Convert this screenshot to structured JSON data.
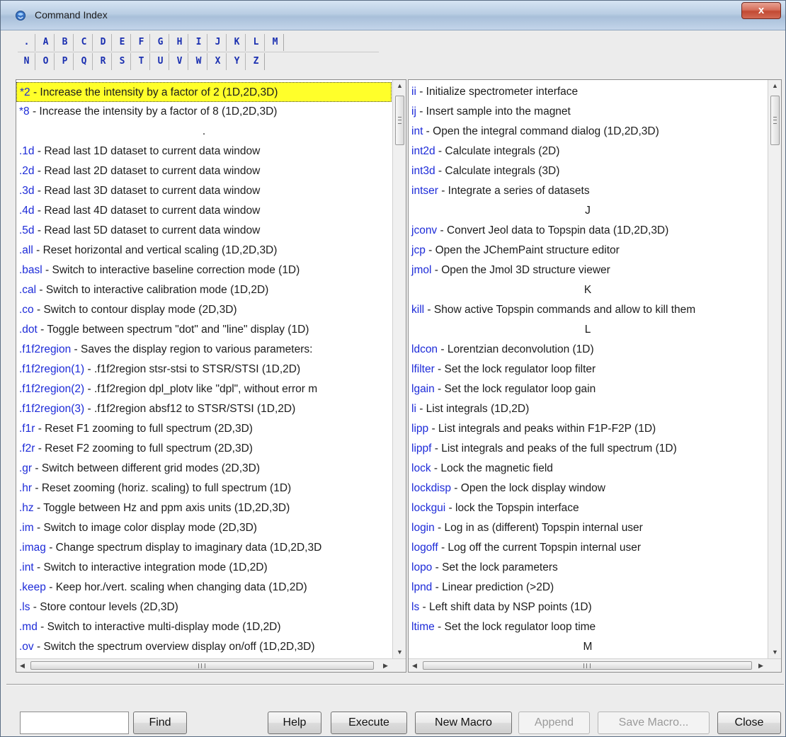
{
  "window": {
    "title": "Command Index",
    "close_label": "x"
  },
  "letters_row1": [
    ".",
    "A",
    "B",
    "C",
    "D",
    "E",
    "F",
    "G",
    "H",
    "I",
    "J",
    "K",
    "L",
    "M"
  ],
  "letters_row2": [
    "N",
    "O",
    "P",
    "Q",
    "R",
    "S",
    "T",
    "U",
    "V",
    "W",
    "X",
    "Y",
    "Z"
  ],
  "left_list": [
    {
      "cmd": "*2",
      "desc": " - Increase the intensity by a factor of 2 (1D,2D,3D)",
      "selected": true
    },
    {
      "cmd": "*8",
      "desc": " - Increase the intensity by a factor of 8 (1D,2D,3D)"
    },
    {
      "header": "."
    },
    {
      "cmd": ".1d",
      "desc": " - Read last 1D dataset to current data window"
    },
    {
      "cmd": ".2d",
      "desc": " - Read last 2D dataset to current data window"
    },
    {
      "cmd": ".3d",
      "desc": " - Read last 3D dataset to current data window"
    },
    {
      "cmd": ".4d",
      "desc": " - Read last 4D dataset to current data window"
    },
    {
      "cmd": ".5d",
      "desc": " - Read last 5D dataset to current data window"
    },
    {
      "cmd": ".all",
      "desc": " - Reset horizontal and vertical scaling (1D,2D,3D)"
    },
    {
      "cmd": ".basl",
      "desc": " - Switch to interactive baseline correction mode (1D)"
    },
    {
      "cmd": ".cal",
      "desc": " - Switch to interactive calibration mode (1D,2D)"
    },
    {
      "cmd": ".co",
      "desc": " - Switch to contour display mode (2D,3D)"
    },
    {
      "cmd": ".dot",
      "desc": " - Toggle between spectrum \"dot\" and \"line\" display (1D)"
    },
    {
      "cmd": ".f1f2region",
      "desc": " - Saves the display region to various parameters:"
    },
    {
      "cmd": ".f1f2region(1)",
      "desc": " - .f1f2region stsr-stsi to STSR/STSI (1D,2D)"
    },
    {
      "cmd": ".f1f2region(2)",
      "desc": " - .f1f2region dpl_plotv like \"dpl\", without error m"
    },
    {
      "cmd": ".f1f2region(3)",
      "desc": " - .f1f2region absf12 to STSR/STSI (1D,2D)"
    },
    {
      "cmd": ".f1r",
      "desc": " - Reset F1 zooming to full spectrum (2D,3D)"
    },
    {
      "cmd": ".f2r",
      "desc": " - Reset F2 zooming to full spectrum (2D,3D)"
    },
    {
      "cmd": ".gr",
      "desc": " - Switch between different grid modes (2D,3D)"
    },
    {
      "cmd": ".hr",
      "desc": " - Reset zooming (horiz. scaling) to full spectrum (1D)"
    },
    {
      "cmd": ".hz",
      "desc": " - Toggle between Hz and ppm axis units (1D,2D,3D)"
    },
    {
      "cmd": ".im",
      "desc": " - Switch to image color display mode (2D,3D)"
    },
    {
      "cmd": ".imag",
      "desc": " - Change spectrum display to imaginary data (1D,2D,3D"
    },
    {
      "cmd": ".int",
      "desc": " - Switch to interactive integration mode (1D,2D)"
    },
    {
      "cmd": ".keep",
      "desc": " - Keep hor./vert. scaling when changing data (1D,2D)"
    },
    {
      "cmd": ".ls",
      "desc": " - Store contour levels (2D,3D)"
    },
    {
      "cmd": ".md",
      "desc": " - Switch to interactive multi-display mode (1D,2D)"
    },
    {
      "cmd": ".ov",
      "desc": " - Switch the spectrum overview display on/off (1D,2D,3D)"
    }
  ],
  "right_list": [
    {
      "cmd": "ii",
      "desc": " - Initialize spectrometer interface"
    },
    {
      "cmd": "ij",
      "desc": " - Insert sample into the magnet"
    },
    {
      "cmd": "int",
      "desc": " - Open the integral command dialog (1D,2D,3D)"
    },
    {
      "cmd": "int2d",
      "desc": " - Calculate integrals (2D)"
    },
    {
      "cmd": "int3d",
      "desc": " - Calculate integrals (3D)"
    },
    {
      "cmd": "intser",
      "desc": " - Integrate a series of datasets"
    },
    {
      "header": "J"
    },
    {
      "cmd": "jconv",
      "desc": " - Convert Jeol data to Topspin data (1D,2D,3D)"
    },
    {
      "cmd": "jcp",
      "desc": " - Open the JChemPaint structure editor"
    },
    {
      "cmd": "jmol",
      "desc": " - Open the Jmol 3D structure viewer"
    },
    {
      "header": "K"
    },
    {
      "cmd": "kill",
      "desc": " - Show active Topspin commands and allow to kill them"
    },
    {
      "header": "L"
    },
    {
      "cmd": "ldcon",
      "desc": " - Lorentzian deconvolution (1D)"
    },
    {
      "cmd": "lfilter",
      "desc": " - Set the lock regulator loop filter"
    },
    {
      "cmd": "lgain",
      "desc": " - Set the lock regulator loop gain"
    },
    {
      "cmd": "li",
      "desc": " - List integrals (1D,2D)"
    },
    {
      "cmd": "lipp",
      "desc": " - List integrals and peaks within F1P-F2P (1D)"
    },
    {
      "cmd": "lippf",
      "desc": " - List integrals and peaks of the full spectrum (1D)"
    },
    {
      "cmd": "lock",
      "desc": " - Lock the magnetic field"
    },
    {
      "cmd": "lockdisp",
      "desc": " - Open the lock display window"
    },
    {
      "cmd": "lockgui",
      "desc": " - lock the Topspin interface"
    },
    {
      "cmd": "login",
      "desc": " - Log in as (different) Topspin internal user"
    },
    {
      "cmd": "logoff",
      "desc": " - Log off the current Topspin internal user"
    },
    {
      "cmd": "lopo",
      "desc": " - Set the lock parameters"
    },
    {
      "cmd": "lpnd",
      "desc": " - Linear prediction (>2D)"
    },
    {
      "cmd": "ls",
      "desc": " - Left shift data by NSP points (1D)"
    },
    {
      "cmd": "ltime",
      "desc": " - Set the lock regulator loop time"
    },
    {
      "header": "M"
    }
  ],
  "find": {
    "value": "",
    "button": "Find"
  },
  "buttons": {
    "help": "Help",
    "execute": "Execute",
    "new_macro": "New Macro",
    "append": "Append",
    "save_macro": "Save Macro...",
    "close": "Close"
  },
  "scroll_grip": "III",
  "colors": {
    "command": "#1d2bd8",
    "selection": "#ffff2a",
    "letters": "#1a2fb0"
  }
}
